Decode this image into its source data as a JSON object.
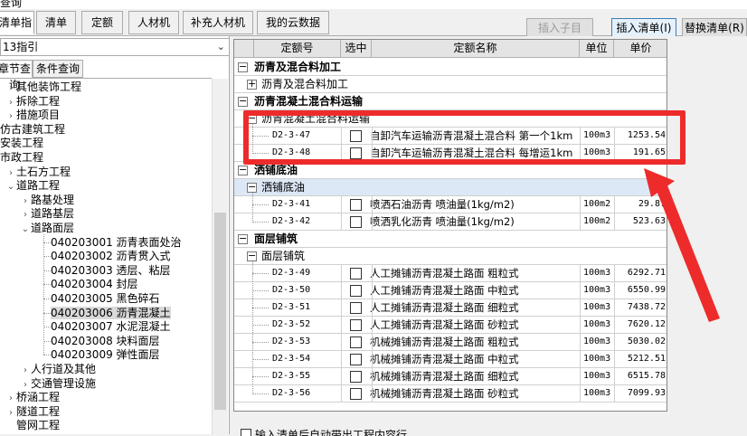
{
  "window": {
    "title": "查询"
  },
  "tabs": [
    "清单指引",
    "清单",
    "定额",
    "人材机",
    "补充人材机",
    "我的云数据"
  ],
  "toolbar": {
    "insert_child": "插入子目",
    "insert_list": "插入清单(I)",
    "replace_list": "替换清单(R)"
  },
  "left": {
    "library": "13指引",
    "subtabs": [
      "章节查询",
      "条件查询"
    ],
    "tree": [
      {
        "label": "其他装饰工程",
        "toggle": "›"
      },
      {
        "label": "拆除工程",
        "toggle": "›"
      },
      {
        "label": "措施项目",
        "toggle": "›"
      },
      {
        "label": "仿古建筑工程",
        "toggle": ""
      },
      {
        "label": "安装工程",
        "toggle": ""
      },
      {
        "label": "市政工程",
        "toggle": ""
      },
      {
        "label": "土石方工程",
        "toggle": "›"
      },
      {
        "label": "道路工程",
        "toggle": "⌄"
      },
      {
        "label": "路基处理",
        "toggle": "›"
      },
      {
        "label": "道路基层",
        "toggle": "›"
      },
      {
        "label": "道路面层",
        "toggle": "⌄"
      },
      {
        "label": "040203001  沥青表面处治",
        "toggle": ""
      },
      {
        "label": "040203002  沥青贯入式",
        "toggle": ""
      },
      {
        "label": "040203003  透层、粘层",
        "toggle": ""
      },
      {
        "label": "040203004  封层",
        "toggle": ""
      },
      {
        "label": "040203005  黑色碎石",
        "toggle": ""
      },
      {
        "label": "040203006  沥青混凝土",
        "toggle": ""
      },
      {
        "label": "040203007  水泥混凝土",
        "toggle": ""
      },
      {
        "label": "040203008  块料面层",
        "toggle": ""
      },
      {
        "label": "040203009  弹性面层",
        "toggle": ""
      },
      {
        "label": "人行道及其他",
        "toggle": "›"
      },
      {
        "label": "交通管理设施",
        "toggle": "›"
      },
      {
        "label": "桥涵工程",
        "toggle": "›"
      },
      {
        "label": "隧道工程",
        "toggle": "›"
      },
      {
        "label": "管网工程",
        "toggle": ""
      }
    ]
  },
  "grid": {
    "columns": [
      "定额号",
      "选中",
      "定额名称",
      "单位",
      "单价"
    ],
    "groups": [
      {
        "title": "沥青及混合料加工",
        "sign": "−",
        "subs": [
          {
            "title": "沥青及混合料加工",
            "sign": "+",
            "rows": []
          }
        ]
      },
      {
        "title": "沥青混凝土混合料运输",
        "sign": "−",
        "subs": [
          {
            "title": "沥青混凝土混合料运输",
            "sign": "−",
            "rows": [
              {
                "code": "D2-3-47",
                "name": "自卸汽车运输沥青混凝土混合料 第一个1km",
                "unit": "100m3",
                "price": "1253.54"
              },
              {
                "code": "D2-3-48",
                "name": "自卸汽车运输沥青混凝土混合料 每增运1km",
                "unit": "100m3",
                "price": "191.65"
              }
            ]
          }
        ]
      },
      {
        "title": "洒铺底油",
        "sign": "−",
        "subs": [
          {
            "title": "洒铺底油",
            "sign": "−",
            "rows": [
              {
                "code": "D2-3-41",
                "name": "喷洒石油沥青 喷油量(1kg/m2)",
                "unit": "100m2",
                "price": "29.87"
              },
              {
                "code": "D2-3-42",
                "name": "喷洒乳化沥青 喷油量(1kg/m2)",
                "unit": "100m2",
                "price": "523.63"
              }
            ]
          }
        ]
      },
      {
        "title": "面层铺筑",
        "sign": "−",
        "subs": [
          {
            "title": "面层铺筑",
            "sign": "−",
            "rows": [
              {
                "code": "D2-3-49",
                "name": "人工摊铺沥青混凝土路面 粗粒式",
                "unit": "100m3",
                "price": "6292.71"
              },
              {
                "code": "D2-3-50",
                "name": "人工摊铺沥青混凝土路面 中粒式",
                "unit": "100m3",
                "price": "6550.99"
              },
              {
                "code": "D2-3-51",
                "name": "人工摊铺沥青混凝土路面 细粒式",
                "unit": "100m3",
                "price": "7438.72"
              },
              {
                "code": "D2-3-52",
                "name": "人工摊铺沥青混凝土路面 砂粒式",
                "unit": "100m3",
                "price": "7620.12"
              },
              {
                "code": "D2-3-53",
                "name": "机械摊铺沥青混凝土路面 粗粒式",
                "unit": "100m3",
                "price": "5030.02"
              },
              {
                "code": "D2-3-54",
                "name": "机械摊铺沥青混凝土路面 中粒式",
                "unit": "100m3",
                "price": "5212.51"
              },
              {
                "code": "D2-3-55",
                "name": "机械摊铺沥青混凝土路面 细粒式",
                "unit": "100m3",
                "price": "6515.78"
              },
              {
                "code": "D2-3-56",
                "name": "机械摊铺沥青混凝土路面 砂粒式",
                "unit": "100m3",
                "price": "7099.93"
              }
            ]
          }
        ]
      }
    ]
  },
  "bottom": {
    "option": "输入清单后自动带出工程内容行"
  },
  "colors": {
    "callout": "#ee2b2b",
    "highlight": "#dce8f6"
  }
}
